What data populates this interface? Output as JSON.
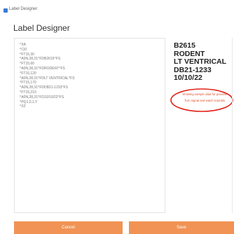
{
  "window": {
    "title": "Label Designer"
  },
  "page": {
    "title": "Label Designer"
  },
  "editor": {
    "lines": [
      "^XA",
      "^CI0",
      "^FT15,30",
      "^A0N,28,31^FDB2615^FS",
      "^FT15,60",
      "^A0N,28,31^FDRODENT^FS",
      "^FT15,120",
      "^A0N,28,31^FDLT VENTRICAL^FS",
      "^FT15,170",
      "^A0N,28,31^FDDB21-1233^FS",
      "^FT15,210",
      "^A0N,28,31^FD10/10/22^FS",
      "^PQ1,0,1,Y",
      "^XZ"
    ]
  },
  "preview": {
    "lines": [
      "B2615",
      "RODENT",
      "LT VENTRICAL",
      "DB21-1233",
      "10/10/22"
    ],
    "notice_line1": "Showing sample data for preview",
    "notice_line2": "Turn signal and watch tutorials"
  },
  "buttons": {
    "cancel": "Cancel",
    "save": "Save"
  },
  "colors": {
    "accent": "#f19354",
    "notice": "#e0532b",
    "annotation": "#e2231a"
  }
}
